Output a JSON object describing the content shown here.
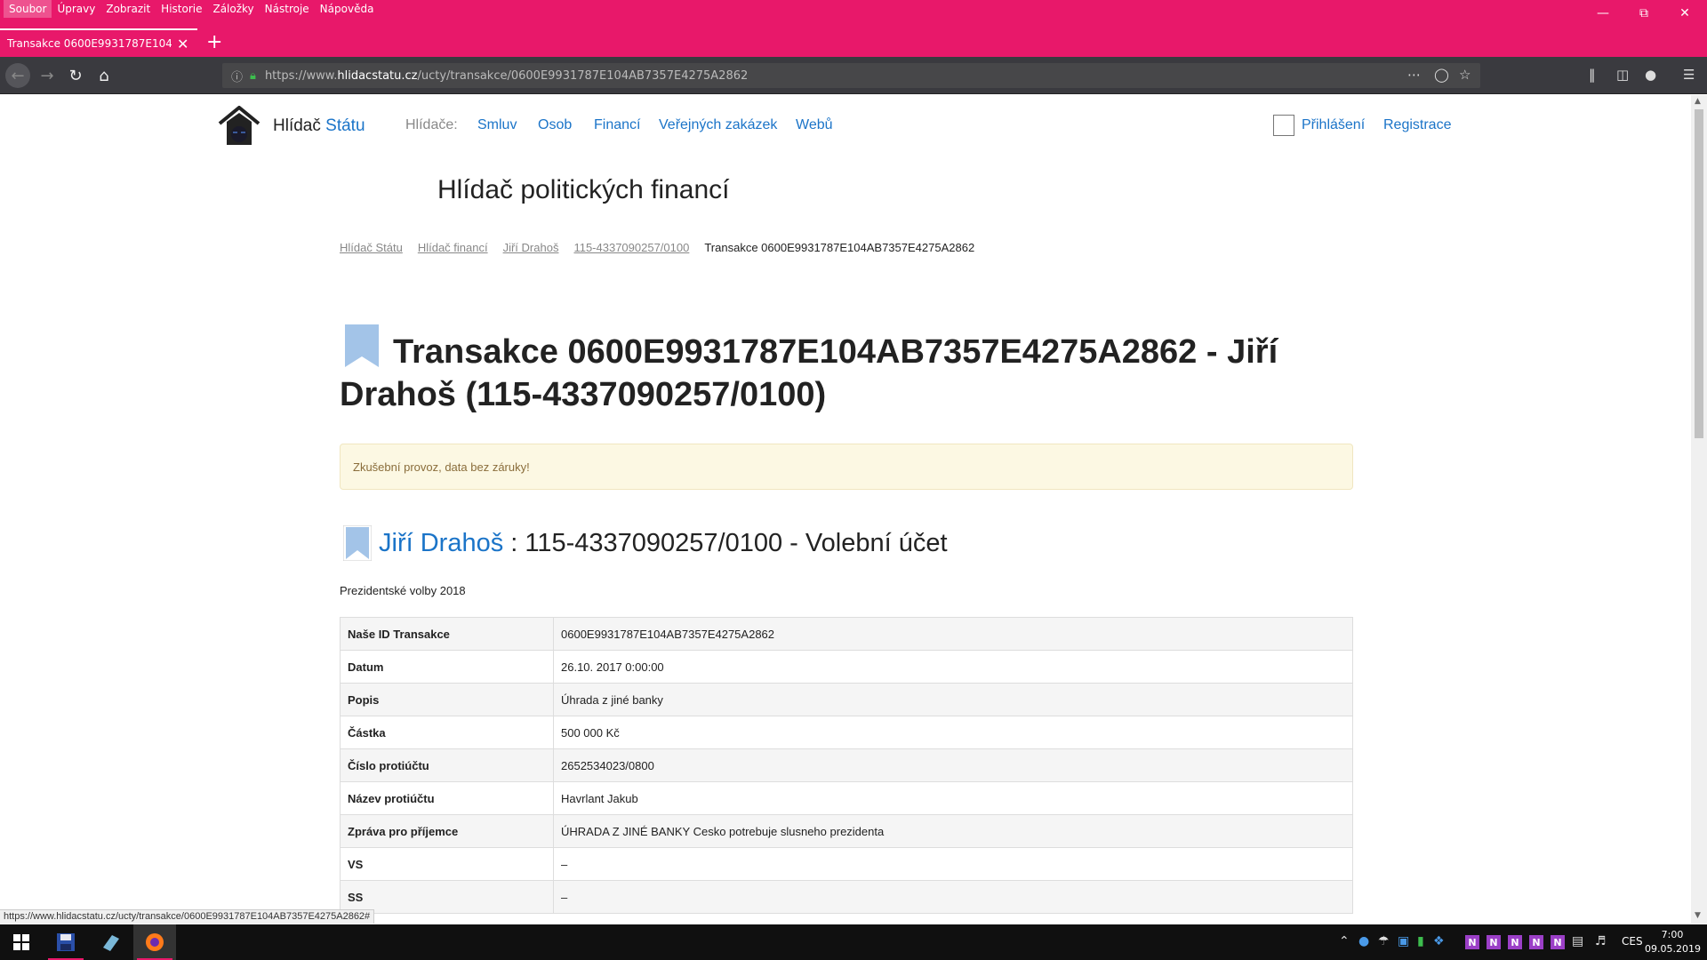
{
  "browser": {
    "menu": [
      "Soubor",
      "Úpravy",
      "Zobrazit",
      "Historie",
      "Záložky",
      "Nástroje",
      "Nápověda"
    ],
    "tab_title": "Transakce 0600E9931787E104AB7357E4275A2862",
    "url_prefix": "https://www.",
    "url_domain": "hlidacstatu.cz",
    "url_path": "/ucty/transakce/0600E9931787E104AB7357E4275A2862",
    "status_url": "https://www.hlidacstatu.cz/ucty/transakce/0600E9931787E104AB7357E4275A2862#"
  },
  "site": {
    "brand_a": "Hlídač",
    "brand_b": "Státu",
    "nav_label": "Hlídače:",
    "nav": [
      "Smluv",
      "Osob",
      "Financí",
      "Veřejných zakázek",
      "Webů"
    ],
    "login": "Přihlášení",
    "register": "Registrace",
    "title": "Hlídač politických financí"
  },
  "breadcrumb": {
    "items": [
      "Hlídač Státu",
      "Hlídač financí",
      "Jiří Drahoš",
      "115-4337090257/0100"
    ],
    "current": "Transakce 0600E9931787E104AB7357E4275A2862"
  },
  "main": {
    "heading": "Transakce 0600E9931787E104AB7357E4275A2862 - Jiří Drahoš (115-4337090257/0100)",
    "alert": "Zkušební provoz, data bez záruky!",
    "account_name": "Jiří Drahoš",
    "account_rest": " : 115-4337090257/0100 - Volební účet",
    "subtitle": "Prezidentské volby 2018",
    "rows": [
      {
        "k": "Naše ID Transakce",
        "v": "0600E9931787E104AB7357E4275A2862"
      },
      {
        "k": "Datum",
        "v": "26.10. 2017 0:00:00"
      },
      {
        "k": "Popis",
        "v": "Úhrada z jiné banky"
      },
      {
        "k": "Částka",
        "v": "500 000 Kč"
      },
      {
        "k": "Číslo protiúčtu",
        "v": "2652534023/0800"
      },
      {
        "k": "Název protiúčtu",
        "v": "Havrlant Jakub"
      },
      {
        "k": "Zpráva pro příjemce",
        "v": "ÚHRADA Z JINÉ BANKY Cesko potrebuje slusneho prezidenta"
      },
      {
        "k": "VS",
        "v": "–"
      },
      {
        "k": "SS",
        "v": "–"
      }
    ]
  },
  "taskbar": {
    "lang": "CES",
    "time": "7:00",
    "date": "09.05.2019"
  },
  "colors": {
    "browser_accent": "#e8186a",
    "link": "#1b74c8",
    "bookmark": "#a3c4e8"
  }
}
